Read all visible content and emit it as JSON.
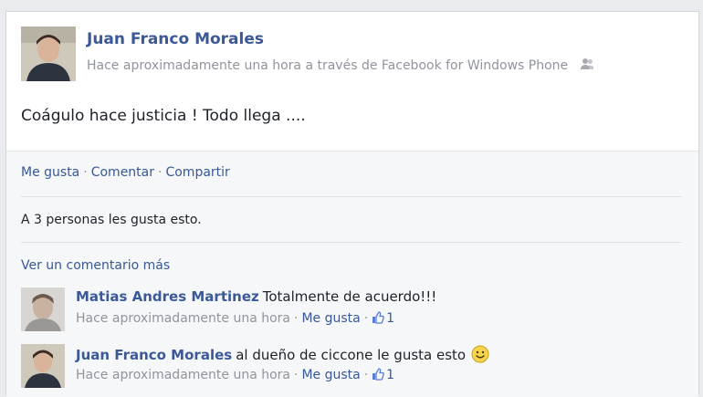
{
  "post": {
    "author": "Juan Franco Morales",
    "meta": "Hace aproximadamente una hora a través de Facebook for Windows Phone",
    "privacy_icon": "friends-icon",
    "text": "Coágulo hace justicia ! Todo llega ...."
  },
  "actions": {
    "like": "Me gusta",
    "comment": "Comentar",
    "share": "Compartir",
    "separator": "·"
  },
  "likes_summary": "A 3 personas les gusta esto.",
  "view_more": "Ver un comentario más",
  "comments": [
    {
      "name": "Matias Andres Martinez",
      "text": "Totalmente de acuerdo!!!",
      "time": "Hace aproximadamente una hora",
      "like_label": "Me gusta",
      "like_count": "1"
    },
    {
      "name": "Juan Franco Morales",
      "text": "al dueño de ciccone le gusta esto",
      "emoji": "smiley-icon",
      "time": "Hace aproximadamente una hora",
      "like_label": "Me gusta",
      "like_count": "1"
    }
  ],
  "colors": {
    "link": "#3b5998",
    "meta": "#90949c",
    "background": "#e9ebee"
  }
}
